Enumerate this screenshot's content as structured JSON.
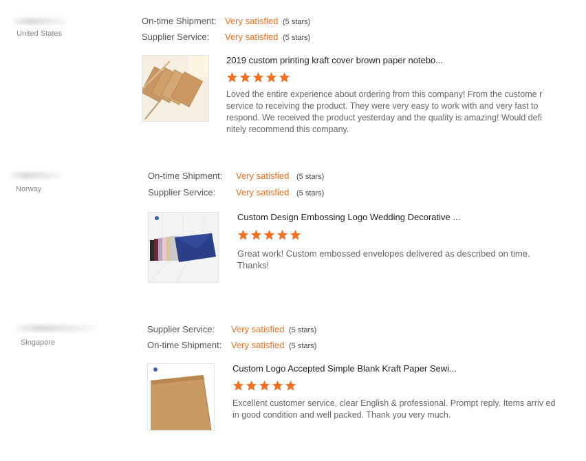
{
  "colors": {
    "accent": "#f36f21",
    "star": "#f36f21"
  },
  "reviews": [
    {
      "country": "United States",
      "ratings": [
        {
          "label": "On-time Shipment:",
          "value": "Very satisfied",
          "stars": "(5 stars)"
        },
        {
          "label": "Supplier Service:",
          "value": "Very satisfied",
          "stars": "(5 stars)"
        }
      ],
      "product_title": "2019 custom printing kraft cover brown paper notebo...",
      "rating": 5,
      "comment": "Loved the entire experience about ordering from this company! From the custome r service to receiving the product. They were very easy to work with and very fast to respond. We received the product yesterday and the quality is amazing! Would defi nitely recommend this company.",
      "thumb_icon": "kraft-notebooks-thumbnail"
    },
    {
      "country": "Norway",
      "ratings": [
        {
          "label": "On-time Shipment:",
          "value": "Very satisfied",
          "stars": "(5 stars)"
        },
        {
          "label": "Supplier Service:",
          "value": "Very satisfied",
          "stars": "(5 stars)"
        }
      ],
      "product_title": "Custom Design Embossing Logo Wedding Decorative ...",
      "rating": 5,
      "comment": "Great work! Custom embossed envelopes delivered as described on time. Thanks!",
      "thumb_icon": "envelopes-thumbnail"
    },
    {
      "country": "Singapore",
      "ratings": [
        {
          "label": "Supplier Service:",
          "value": "Very satisfied",
          "stars": "(5 stars)"
        },
        {
          "label": "On-time Shipment:",
          "value": "Very satisfied",
          "stars": "(5 stars)"
        }
      ],
      "product_title": "Custom Logo Accepted Simple Blank Kraft Paper Sewi...",
      "rating": 5,
      "comment": "Excellent customer service, clear English & professional. Prompt reply. Items arriv ed in good condition and well packed. Thank you very much.",
      "thumb_icon": "kraft-notebook-thumbnail"
    }
  ]
}
